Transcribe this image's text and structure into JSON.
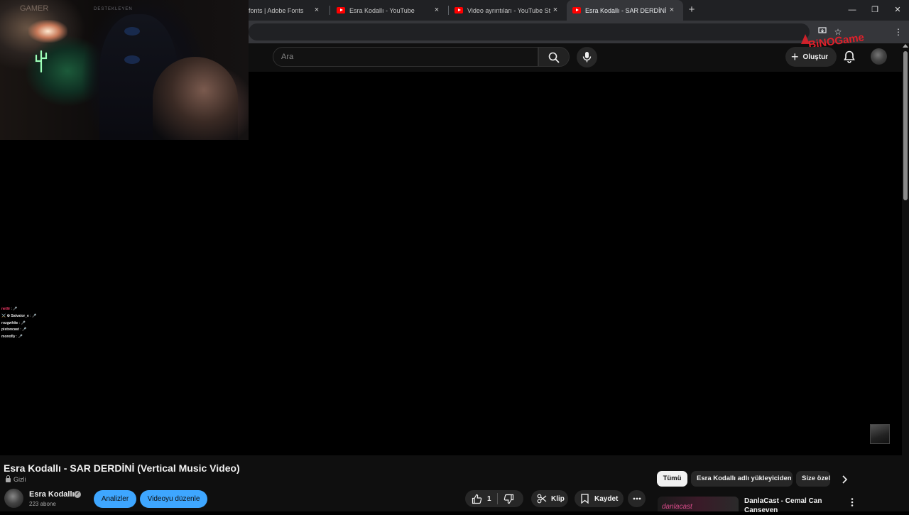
{
  "browser": {
    "tabs": [
      {
        "title": "fonts | Adobe Fonts",
        "active": false,
        "icon": "none"
      },
      {
        "title": "Esra Kodallı - YouTube",
        "active": false,
        "icon": "youtube-icon"
      },
      {
        "title": "Video ayrıntıları - YouTube Studio",
        "active": false,
        "icon": "youtube-icon"
      },
      {
        "title": "Esra Kodallı - SAR DERDİNİ (Vertical Music Video)",
        "active": true,
        "icon": "youtube-icon"
      }
    ],
    "new_tab": "+",
    "close_glyph": "×",
    "window_controls": {
      "minimize": "—",
      "restore": "❐",
      "close": "✕"
    }
  },
  "youtube": {
    "search_placeholder": "Ara",
    "create_label": "Oluştur",
    "accent": "#3ea6ff"
  },
  "video": {
    "title": "Esra Kodallı - SAR DERDİNİ (Vertical Music Video)",
    "privacy": "Gizli",
    "channel_name": "Esra Kodallı",
    "subscribers": "223 abone",
    "analytics_label": "Analizler",
    "edit_label": "Videoyu düzenle",
    "like_count": "1",
    "clip_label": "Klip",
    "save_label": "Kaydet"
  },
  "sidebar": {
    "chips": [
      "Tümü",
      "Esra Kodallı adlı yükleyiciden",
      "Size özel"
    ],
    "recommendation": {
      "title": "DanlaCast - Cemal Can Canseven",
      "thumb_text": "danlacast"
    }
  },
  "stream_overlay": {
    "watermark": "BiNOGame",
    "webcam_sign": "GAMER",
    "webcam_sign2": "DESTEKLEYEN",
    "chat": [
      {
        "user": "netlir",
        "msg": "🎤"
      },
      {
        "user": "Salvator_e",
        "msg": "🎤",
        "prefix": "⚔️ ⚙"
      },
      {
        "user": "rozgwhite",
        "msg": "🎤"
      },
      {
        "user": "pistoncast",
        "msg": "🎤"
      },
      {
        "user": "monofly",
        "msg": "🎤"
      }
    ]
  }
}
